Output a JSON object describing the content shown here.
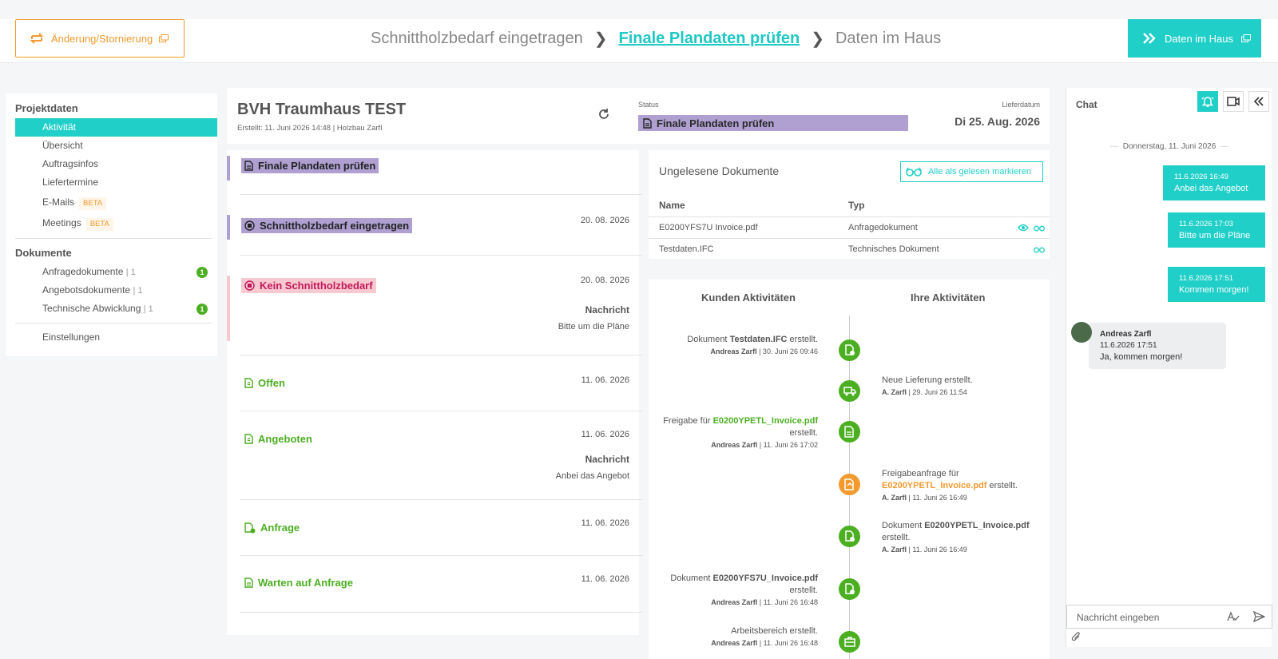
{
  "topbar": {
    "change_label": "Änderung/Stornierung",
    "steps": [
      "Schnittholzbedarf eingetragen",
      "Finale Plandaten prüfen",
      "Daten im Haus"
    ],
    "daten_label": "Daten im Haus"
  },
  "sidebar": {
    "projekt_head": "Projektdaten",
    "projekt_items": [
      {
        "label": "Aktivität"
      },
      {
        "label": "Übersicht"
      },
      {
        "label": "Auftragsinfos"
      },
      {
        "label": "Liefertermine"
      },
      {
        "label": "E-Mails",
        "badge": "BETA"
      },
      {
        "label": "Meetings",
        "badge": "BETA"
      }
    ],
    "doc_head": "Dokumente",
    "doc_items": [
      {
        "label": "Anfragedokumente",
        "count": "| 1",
        "dot": "1"
      },
      {
        "label": "Angebotsdokumente",
        "count": "| 1"
      },
      {
        "label": "Technische Abwicklung",
        "count": "| 1",
        "dot": "1"
      }
    ],
    "settings": "Einstellungen"
  },
  "project": {
    "title": "BVH Traumhaus TEST",
    "meta": "Erstellt: 11. Juni 2026 14:48 | Holzbau Zarfl",
    "status_label": "Status",
    "status_value": "Finale Plandaten prüfen",
    "delivery_label": "Lieferdatum",
    "delivery_value": "Di 25. Aug. 2026"
  },
  "timeline": [
    {
      "label": "Finale Plandaten prüfen",
      "date": ""
    },
    {
      "label": "Schnittholzbedarf eingetragen",
      "date": "20. 08. 2026"
    },
    {
      "label": "Kein Schnittholzbedarf",
      "date": "20. 08. 2026",
      "msg_head": "Nachricht",
      "msg": "Bitte um die Pläne"
    },
    {
      "label": "Offen",
      "date": "11. 06. 2026"
    },
    {
      "label": "Angeboten",
      "date": "11. 06. 2026",
      "msg_head": "Nachricht",
      "msg": "Anbei das Angebot"
    },
    {
      "label": "Anfrage",
      "date": "11. 06. 2026"
    },
    {
      "label": "Warten auf Anfrage",
      "date": "11. 06. 2026"
    }
  ],
  "docs": {
    "title": "Ungelesene Dokumente",
    "mark_all": "Alle als gelesen markieren",
    "col_name": "Name",
    "col_type": "Typ",
    "rows": [
      {
        "name": "E0200YFS7U Invoice.pdf",
        "type": "Anfragedokument"
      },
      {
        "name": "Testdaten.IFC",
        "type": "Technisches Dokument"
      }
    ]
  },
  "activities": {
    "customer_head": "Kunden Aktivitäten",
    "your_head": "Ihre Aktivitäten",
    "items": [
      {
        "side": "left",
        "pre": "Dokument ",
        "bold": "Testdaten.IFC",
        "post": " erstellt.",
        "user": "Andreas Zarfl",
        "when": "| 30. Juni 26 09:46"
      },
      {
        "side": "right",
        "pre": "Neue Lieferung erstellt.",
        "bold": "",
        "post": "",
        "user": "A. Zarfl",
        "when": "| 29. Juni 26 11:54"
      },
      {
        "side": "left",
        "pre": "Freigabe für ",
        "bold": "E0200YPETL_Invoice.pdf",
        "post": "erstellt.",
        "user": "Andreas Zarfl",
        "when": "| 11. Juni 26 17:02"
      },
      {
        "side": "right",
        "pre": "Freigabeanfrage für ",
        "bold": "E0200YPETL_Invoice.pdf",
        "post": " erstellt.",
        "user": "A. Zarfl",
        "when": "| 11. Juni 26 16:49"
      },
      {
        "side": "right",
        "pre": "Dokument ",
        "bold": "E0200YPETL_Invoice.pdf",
        "post": "erstellt.",
        "user": "A. Zarfl",
        "when": "| 11. Juni 26 16:49"
      },
      {
        "side": "left",
        "pre": "Dokument ",
        "bold": "E0200YFS7U_Invoice.pdf",
        "post": "erstellt.",
        "user": "Andreas Zarfl",
        "when": "| 11. Juni 26 16:48"
      },
      {
        "side": "left",
        "pre": "Arbeitsbereich erstellt.",
        "bold": "",
        "post": "",
        "user": "Andreas Zarfl",
        "when": "| 11. Juni 26 16:48"
      }
    ]
  },
  "chat": {
    "title": "Chat",
    "date": "Donnerstag, 11. Juni 2026",
    "outgoing": [
      {
        "time": "11.6.2026 16:49",
        "text": "Anbei das Angebot"
      },
      {
        "time": "11.6.2026 17:03",
        "text": "Bitte um die Pläne"
      },
      {
        "time": "11.6.2026 17:51",
        "text": "Kommen morgen!"
      }
    ],
    "incoming": {
      "name": "Andreas Zarfl",
      "time": "11.6.2026 17:51",
      "text": "Ja, kommen morgen!"
    },
    "input_placeholder": "Nachricht eingeben"
  },
  "colors": {
    "accent": "#21cfc9",
    "orange": "#f29a2e",
    "green": "#4caf22",
    "purple": "#b0a0d2",
    "pink": "#f8c9d0"
  }
}
